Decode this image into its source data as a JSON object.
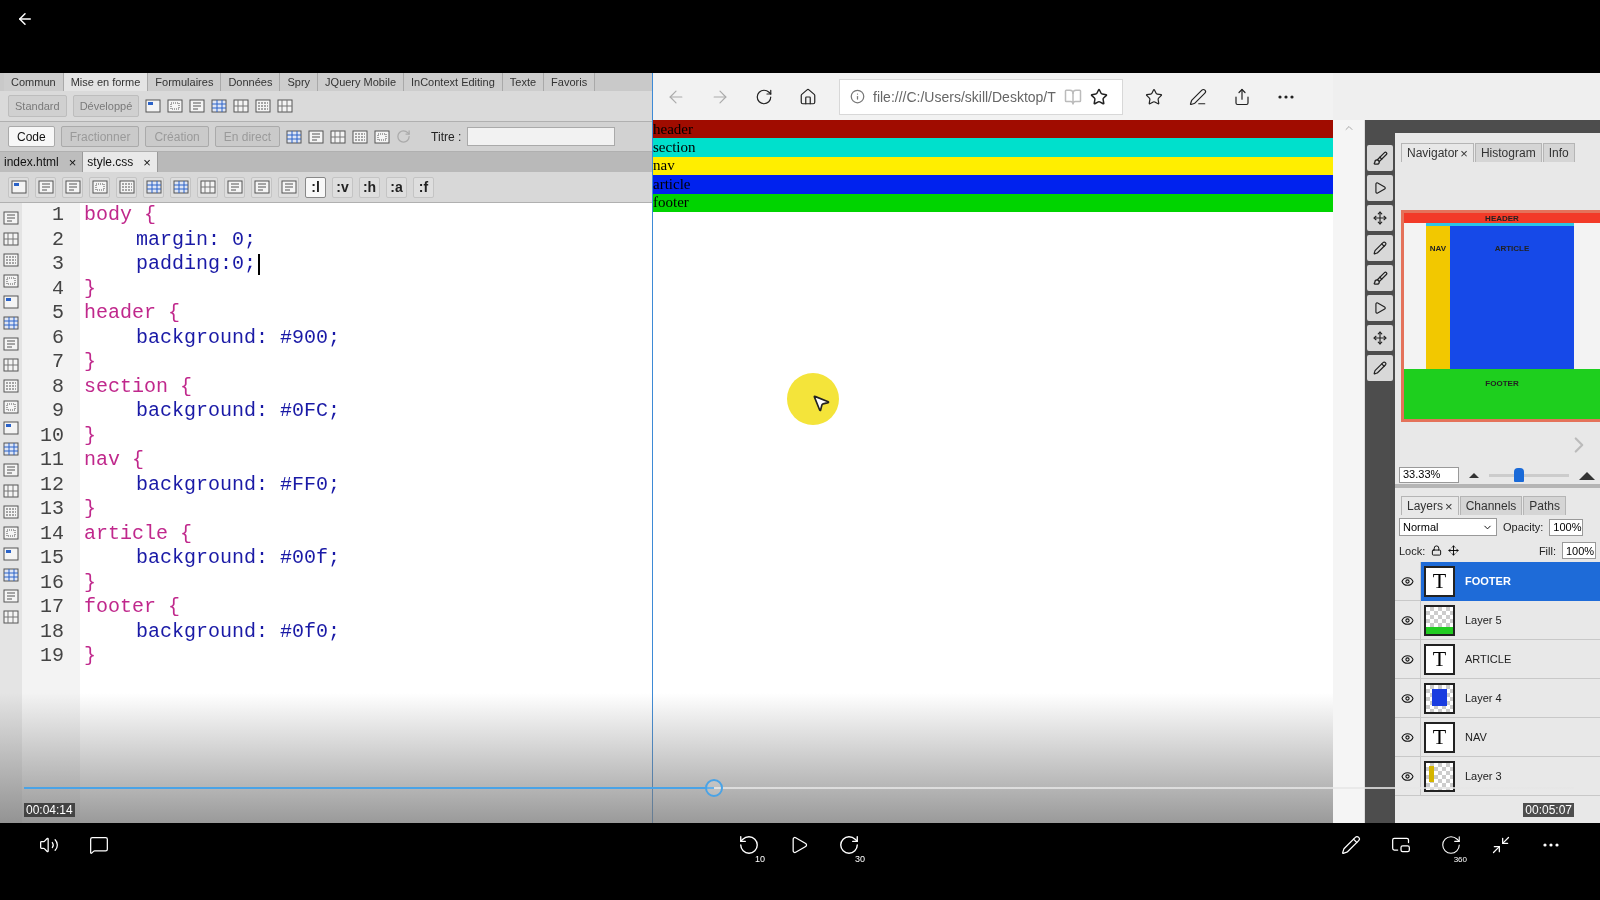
{
  "player": {
    "elapsed": "00:04:14",
    "remaining": "00:05:07",
    "level": 0.445,
    "left_controls": [
      {
        "kind": "volume"
      },
      {
        "kind": "captions"
      }
    ],
    "center_controls": [
      {
        "kind": "rewind",
        "label": "10"
      },
      {
        "kind": "play"
      },
      {
        "kind": "forward",
        "label": "30"
      }
    ],
    "right_controls": [
      {
        "kind": "draw"
      },
      {
        "kind": "mini"
      },
      {
        "kind": "vr",
        "label": "360"
      },
      {
        "kind": "exit-full"
      },
      {
        "kind": "more"
      }
    ]
  },
  "editor": {
    "menu_tabs": [
      {
        "label": "Commun",
        "selected": false
      },
      {
        "label": "Mise en forme",
        "selected": true
      },
      {
        "label": "Formulaires",
        "selected": false
      },
      {
        "label": "Données",
        "selected": false
      },
      {
        "label": "Spry",
        "selected": false
      },
      {
        "label": "JQuery Mobile",
        "selected": false
      },
      {
        "label": "InContext Editing",
        "selected": false
      },
      {
        "label": "Texte",
        "selected": false
      },
      {
        "label": "Favoris",
        "selected": false
      }
    ],
    "layout_modes": [
      {
        "label": "Standard",
        "disabled": true
      },
      {
        "label": "Développé",
        "disabled": true
      }
    ],
    "document_modes": [
      {
        "label": "Code",
        "selected": true
      },
      {
        "label": "Fractionner",
        "selected": false
      },
      {
        "label": "Création",
        "selected": false
      },
      {
        "label": "En direct",
        "selected": false
      }
    ],
    "title_label": "Titre :",
    "file_tabs": [
      {
        "label": "index.html",
        "close": "×",
        "selected": false
      },
      {
        "label": "style.css",
        "close": "×",
        "selected": true
      }
    ],
    "pseudo_buttons": [
      {
        "label": ":l",
        "selected": true
      },
      {
        "label": ":v",
        "selected": false
      },
      {
        "label": ":h",
        "selected": false
      },
      {
        "label": ":a",
        "selected": false
      },
      {
        "label": ":f",
        "selected": false
      }
    ],
    "code_lines": [
      {
        "number": "1",
        "text": "body {",
        "kind": "selector",
        "cursor": false
      },
      {
        "number": "2",
        "text": "margin: 0;",
        "kind": "declaration",
        "cursor": false
      },
      {
        "number": "3",
        "text": "padding:0;",
        "kind": "declaration",
        "cursor": true
      },
      {
        "number": "4",
        "text": "}",
        "kind": "close",
        "cursor": false
      },
      {
        "number": "5",
        "text": "header {",
        "kind": "selector",
        "cursor": false
      },
      {
        "number": "6",
        "text": "background: #900;",
        "kind": "declaration",
        "cursor": false
      },
      {
        "number": "7",
        "text": "}",
        "kind": "close",
        "cursor": false
      },
      {
        "number": "8",
        "text": "section {",
        "kind": "selector",
        "cursor": false
      },
      {
        "number": "9",
        "text": "background: #0FC;",
        "kind": "declaration",
        "cursor": false
      },
      {
        "number": "10",
        "text": "}",
        "kind": "close",
        "cursor": false
      },
      {
        "number": "11",
        "text": "nav {",
        "kind": "selector",
        "cursor": false
      },
      {
        "number": "12",
        "text": "background: #FF0;",
        "kind": "declaration",
        "cursor": false
      },
      {
        "number": "13",
        "text": "}",
        "kind": "close",
        "cursor": false
      },
      {
        "number": "14",
        "text": "article {",
        "kind": "selector",
        "cursor": false
      },
      {
        "number": "15",
        "text": "background: #00f;",
        "kind": "declaration",
        "cursor": false
      },
      {
        "number": "16",
        "text": "}",
        "kind": "close",
        "cursor": false
      },
      {
        "number": "17",
        "text": "footer {",
        "kind": "selector",
        "cursor": false
      },
      {
        "number": "18",
        "text": "background: #0f0;",
        "kind": "declaration",
        "cursor": false
      },
      {
        "number": "19",
        "text": "}",
        "kind": "close",
        "cursor": false
      }
    ]
  },
  "browser": {
    "url": "file:///C:/Users/skill/Desktop/T",
    "blocks": [
      {
        "label": "header",
        "color": "#a00c00"
      },
      {
        "label": "section",
        "color": "#00e0cc"
      },
      {
        "label": "nav",
        "color": "#ffee00"
      },
      {
        "label": "article",
        "color": "#0022ee"
      },
      {
        "label": "footer",
        "color": "#00d400"
      }
    ]
  },
  "photoshop": {
    "navigator_tabs": [
      {
        "label": "Navigator",
        "close": "×",
        "selected": true
      },
      {
        "label": "Histogram",
        "selected": false
      },
      {
        "label": "Info",
        "selected": false
      }
    ],
    "preview_labels": {
      "header": "HEADER",
      "nav": "NAV",
      "article": "ARTICLE",
      "footer": "FOOTER"
    },
    "zoom": "33.33%",
    "zoom_slider": {
      "level": 0.35
    },
    "layer_tabs": [
      {
        "label": "Layers",
        "close": "×",
        "selected": true
      },
      {
        "label": "Channels",
        "selected": false
      },
      {
        "label": "Paths",
        "selected": false
      }
    ],
    "blend_mode": "Normal",
    "opacity_label": "Opacity:",
    "opacity": "100%",
    "lock_label": "Lock:",
    "fill_label": "Fill:",
    "fill": "100%",
    "layers": [
      {
        "name": "FOOTER",
        "kind": "text",
        "glyph": "T",
        "selected": true
      },
      {
        "name": "Layer 5",
        "kind": "band",
        "color": "#22cc22",
        "selected": false
      },
      {
        "name": "ARTICLE",
        "kind": "text",
        "glyph": "T",
        "selected": false
      },
      {
        "name": "Layer 4",
        "kind": "block",
        "color": "#1a3de0",
        "selected": false
      },
      {
        "name": "NAV",
        "kind": "text",
        "glyph": "T",
        "selected": false
      },
      {
        "name": "Layer 3",
        "kind": "bar",
        "color": "#d4b400",
        "selected": false
      }
    ]
  }
}
